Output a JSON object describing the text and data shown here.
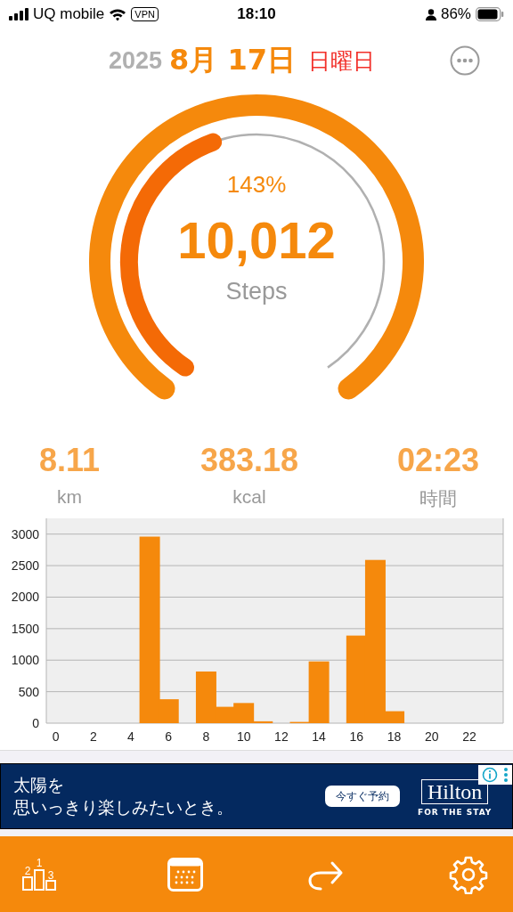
{
  "status_bar": {
    "carrier": "UQ mobile",
    "vpn": "VPN",
    "time": "18:10",
    "battery": "86%"
  },
  "date": {
    "year": "2025",
    "month_day": "8月 17日",
    "weekday": "日曜日"
  },
  "ring": {
    "percent": "143%",
    "steps": "10,012",
    "unit": "Steps"
  },
  "stats": [
    {
      "value": "8.11",
      "unit": "km"
    },
    {
      "value": "383.18",
      "unit": "kcal"
    },
    {
      "value": "02:23",
      "unit": "時間"
    }
  ],
  "chart_data": {
    "type": "bar",
    "x": [
      0,
      1,
      2,
      3,
      4,
      5,
      6,
      7,
      8,
      9,
      10,
      11,
      12,
      13,
      14,
      15,
      16,
      17,
      18,
      19,
      20,
      21,
      22,
      23
    ],
    "series": [
      {
        "color": "#f5890c",
        "values": [
          0,
          0,
          0,
          0,
          0,
          2960,
          380,
          0,
          820,
          260,
          320,
          30,
          0,
          20,
          980,
          0,
          1390,
          2590,
          190,
          0,
          0,
          0,
          0,
          0
        ]
      }
    ],
    "ylim": [
      0,
      3250
    ],
    "xlim": [
      -0.5,
      23.8
    ],
    "yticks": [
      0,
      500,
      1000,
      1500,
      2000,
      2500,
      3000
    ],
    "xticks": [
      0,
      2,
      4,
      6,
      8,
      10,
      12,
      14,
      16,
      18,
      20,
      22
    ],
    "grid": true
  },
  "ad": {
    "headline": [
      "太陽を",
      "思いっきり楽しみたいとき。"
    ],
    "button": "今すぐ予約",
    "brand": "Hilton",
    "tagline": "FOR THE STAY"
  },
  "nav": {
    "ranking_digits": [
      "1",
      "2",
      "3"
    ]
  }
}
